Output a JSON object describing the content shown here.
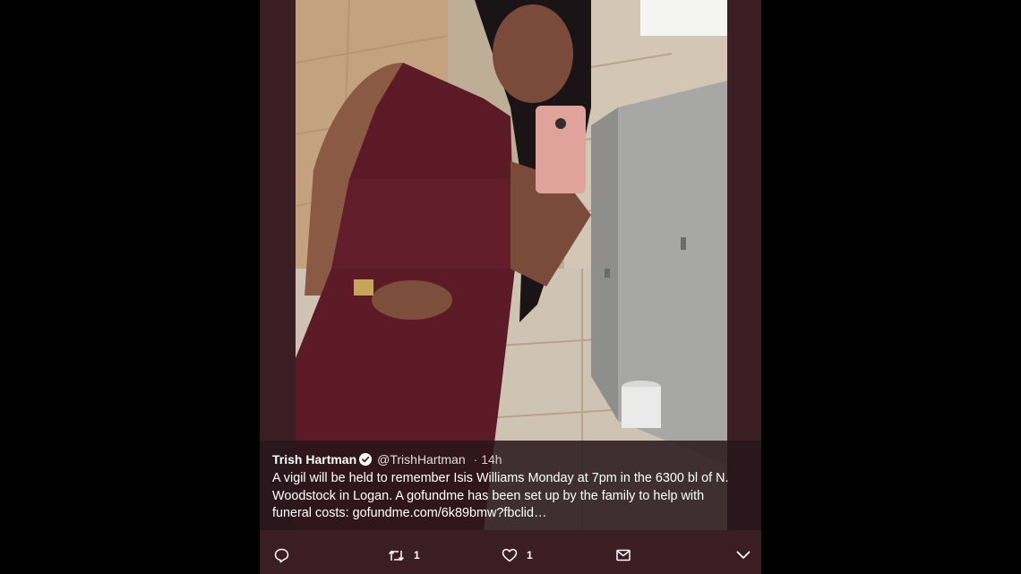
{
  "tweet": {
    "author_name": "Trish Hartman",
    "verified_icon": "verified-badge-icon",
    "handle": "@TrishHartman",
    "separator": "·",
    "time": "14h",
    "text": "A vigil will be held to remember Isis Williams Monday at 7pm in the 6300 bl of N. Woodstock in Logan. A gofundme has been set up by the family to help with funeral costs: ",
    "link_text": "gofundme.com/6k89bmw?fbclid…"
  },
  "actions": {
    "reply_icon": "reply-icon",
    "retweet_icon": "retweet-icon",
    "retweet_count": "1",
    "like_icon": "heart-icon",
    "like_count": "1",
    "message_icon": "envelope-icon",
    "more_icon": "chevron-down-icon"
  },
  "colors": {
    "page_background": "#000000",
    "card_background": "#3a1e24",
    "text": "#ffffff"
  }
}
